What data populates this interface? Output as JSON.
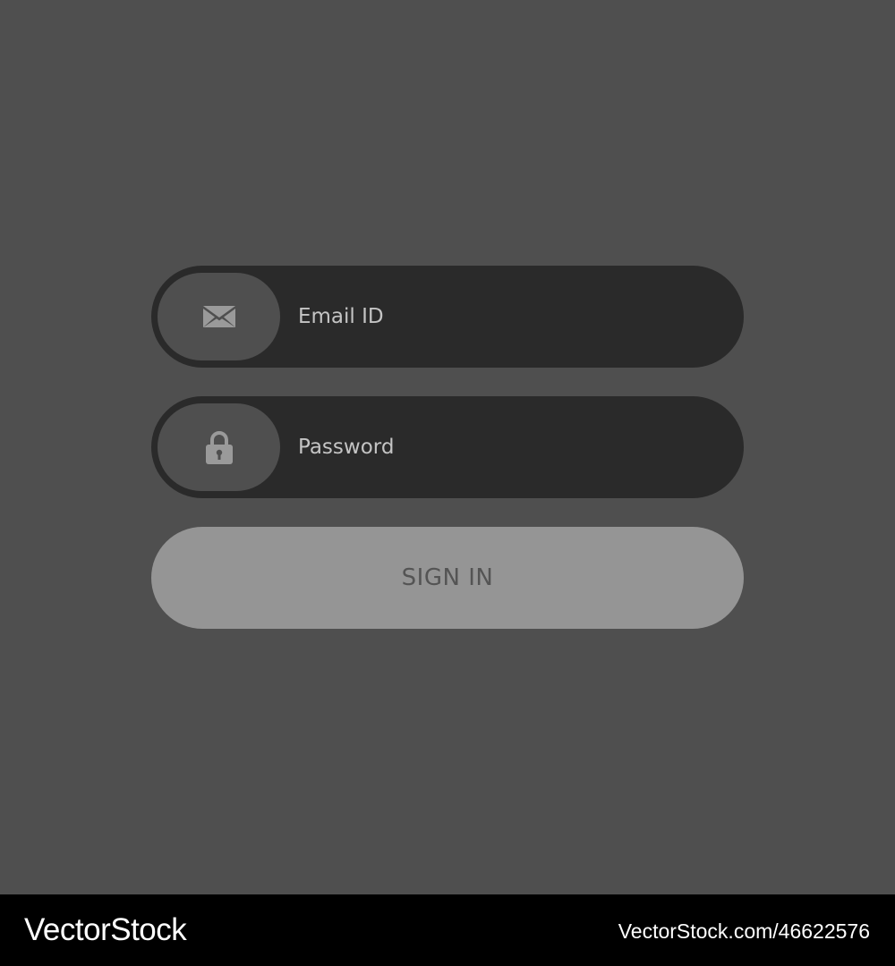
{
  "form": {
    "email": {
      "icon": "envelope-icon",
      "placeholder": "Email ID",
      "value": ""
    },
    "password": {
      "icon": "lock-icon",
      "placeholder": "Password",
      "value": ""
    },
    "signin_label": "SIGN IN"
  },
  "watermark": {
    "logo": "VectorStock",
    "image_ref": "VectorStock.com/46622576"
  },
  "colors": {
    "background": "#4f4f4f",
    "field_fill": "#2a2a2a",
    "icon_pill": "#4f4f4f",
    "icon_color": "#9a9a9a",
    "button_fill": "#959595",
    "button_text": "#545454",
    "placeholder_text": "#c4c4c4",
    "watermark_bar": "#000000"
  }
}
